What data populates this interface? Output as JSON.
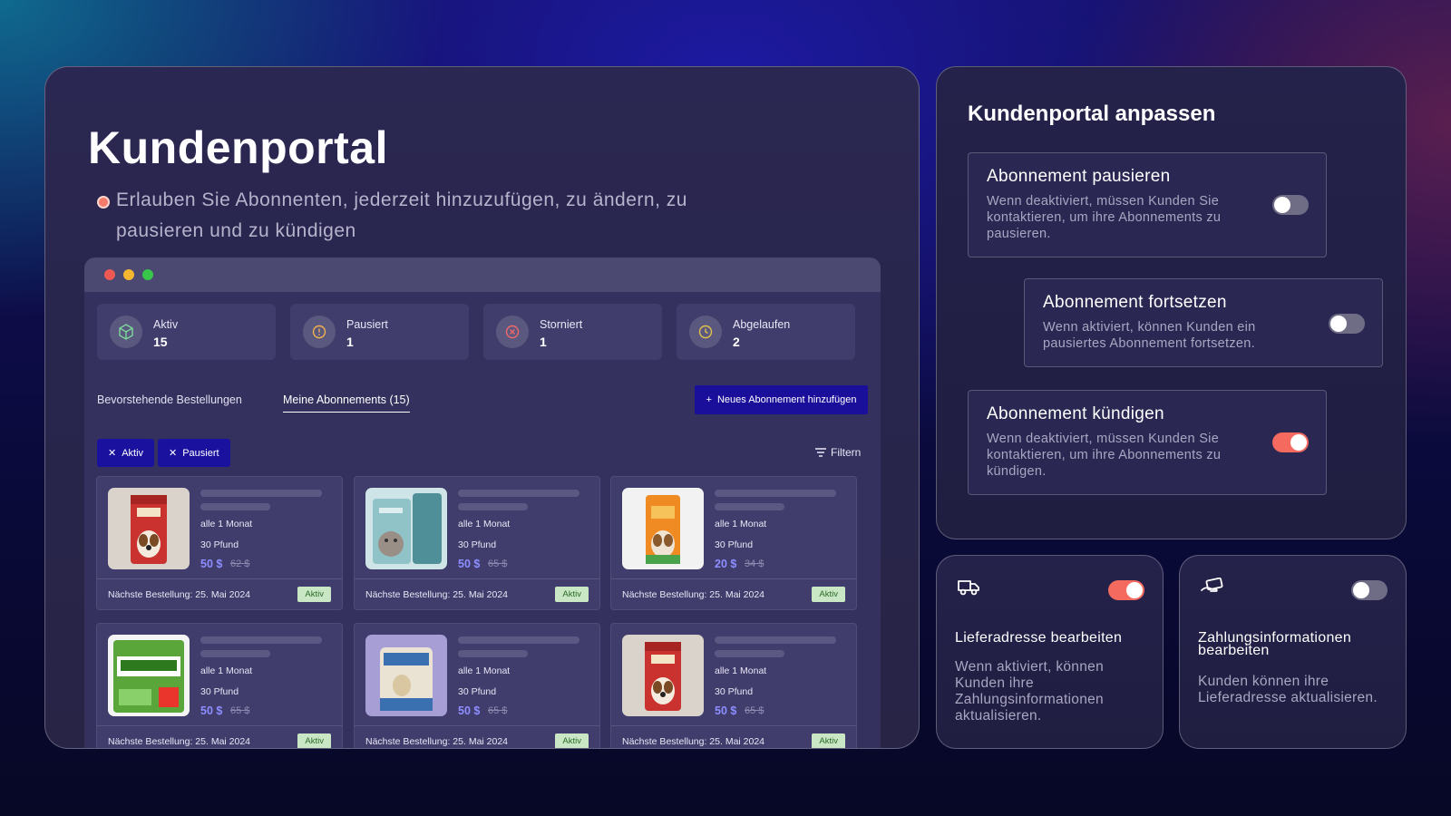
{
  "main": {
    "title": "Kundenportal",
    "subtitle": "Erlauben Sie Abonnenten, jederzeit hinzuzufügen, zu ändern, zu pausieren und zu kündigen"
  },
  "stats": [
    {
      "label": "Aktiv",
      "value": "15",
      "icon": "box-icon",
      "color": "#7cd99a"
    },
    {
      "label": "Pausiert",
      "value": "1",
      "icon": "pause-circle-icon",
      "color": "#f0b24a"
    },
    {
      "label": "Storniert",
      "value": "1",
      "icon": "x-circle-icon",
      "color": "#f06a6a"
    },
    {
      "label": "Abgelaufen",
      "value": "2",
      "icon": "clock-icon",
      "color": "#e0c24a"
    }
  ],
  "tabs": {
    "upcoming": "Bevorstehende Bestellungen",
    "mine": "Meine Abonnements (15)"
  },
  "add_button": "Neues Abonnement hinzufügen",
  "chips": [
    "Aktiv",
    "Pausiert"
  ],
  "filter_label": "Filtern",
  "products": [
    {
      "freq": "alle 1 Monat",
      "weight": "30 Pfund",
      "price": "50 $",
      "old": "62 $",
      "next": "Nächste Bestellung: 25. Mai 2024",
      "status": "Aktiv",
      "img": "red-dog-food-bag"
    },
    {
      "freq": "alle 1 Monat",
      "weight": "30 Pfund",
      "price": "50 $",
      "old": "65 $",
      "next": "Nächste Bestellung: 25. Mai 2024",
      "status": "Aktiv",
      "img": "teal-cat-food-bag"
    },
    {
      "freq": "alle 1 Monat",
      "weight": "30 Pfund",
      "price": "20 $",
      "old": "34 $",
      "next": "Nächste Bestellung: 25. Mai 2024",
      "status": "Aktiv",
      "img": "orange-pet-food-bag"
    },
    {
      "freq": "alle 1 Monat",
      "weight": "30 Pfund",
      "price": "50 $",
      "old": "65 $",
      "next": "Nächste Bestellung: 25. Mai 2024",
      "status": "Aktiv",
      "img": "temptations-treats-bag"
    },
    {
      "freq": "alle 1 Monat",
      "weight": "30 Pfund",
      "price": "50 $",
      "old": "65 $",
      "next": "Nächste Bestellung: 25. Mai 2024",
      "status": "Aktiv",
      "img": "fresh-kisses-treats-bag"
    },
    {
      "freq": "alle 1 Monat",
      "weight": "30 Pfund",
      "price": "50 $",
      "old": "65 $",
      "next": "Nächste Bestellung: 25. Mai 2024",
      "status": "Aktiv",
      "img": "red-dog-food-bag"
    }
  ],
  "customize": {
    "title": "Kundenportal anpassen",
    "options": [
      {
        "title": "Abonnement pausieren",
        "desc": "Wenn deaktiviert, müssen Kunden Sie kontaktieren, um ihre Abonnements zu pausieren.",
        "enabled": false
      },
      {
        "title": "Abonnement fortsetzen",
        "desc": "Wenn aktiviert, können Kunden ein pausiertes Abonnement fortsetzen.",
        "enabled": false
      },
      {
        "title": "Abonnement kündigen",
        "desc": "Wenn deaktiviert, müssen Kunden Sie kontaktieren, um ihre Abonnements zu kündigen.",
        "enabled": true
      }
    ]
  },
  "small_cards": [
    {
      "title": "Lieferadresse bearbeiten",
      "desc": "Wenn aktiviert, können Kunden ihre Zahlungsinformationen aktualisieren.",
      "enabled": true,
      "icon": "delivery-truck-icon"
    },
    {
      "title": "Zahlungsinformationen bearbeiten",
      "desc": "Kunden können ihre Lieferadresse aktualisieren.",
      "enabled": false,
      "icon": "payment-hand-icon"
    }
  ],
  "colors": {
    "accent": "#f46a5e",
    "primary_button": "#1a0f9a",
    "price": "#8d8eff"
  }
}
